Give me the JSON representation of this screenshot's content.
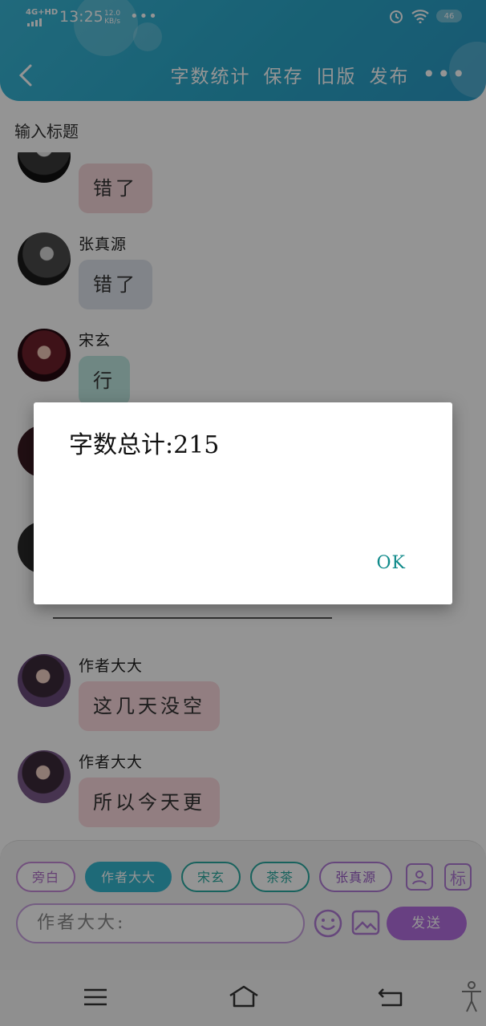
{
  "status_bar": {
    "network": "4G+HD",
    "time": "13:25",
    "speed_value": "12.0",
    "speed_unit": "KB/s",
    "dots": "•••",
    "battery": "46"
  },
  "header": {
    "actions": [
      "字数统计",
      "保存",
      "旧版",
      "发布"
    ],
    "more": "•••"
  },
  "title_placeholder": "输入标题",
  "messages": [
    {
      "sender": "",
      "text": "错了",
      "avatar": "male-dark",
      "bubble_color": "#f4d6da"
    },
    {
      "sender": "张真源",
      "text": "错了",
      "avatar": "male-dark",
      "bubble_color": "#dfe4ec"
    },
    {
      "sender": "宋玄",
      "text": "行",
      "avatar": "male-red",
      "bubble_color": "#bfe8e2"
    },
    {
      "sender": "作者大大",
      "text": "这几天没空",
      "avatar": "female",
      "bubble_color": "#fbd9de"
    },
    {
      "sender": "作者大大",
      "text": "所以今天更",
      "avatar": "female",
      "bubble_color": "#fbd9de"
    }
  ],
  "roles": [
    "旁白",
    "作者大大",
    "宋玄",
    "茶茶",
    "张真源"
  ],
  "panel": {
    "user_icon": "user-card-icon",
    "tag_label": "标",
    "input_placeholder": "作者大大:",
    "send_label": "发送"
  },
  "dialog": {
    "message": "字数总计:215",
    "ok_label": "OK"
  },
  "colors": {
    "header": "#2aa7c9",
    "accent_purple": "#b46fe0",
    "accent_cyan": "#34b7cf",
    "ok_teal": "#0f8a8a"
  }
}
